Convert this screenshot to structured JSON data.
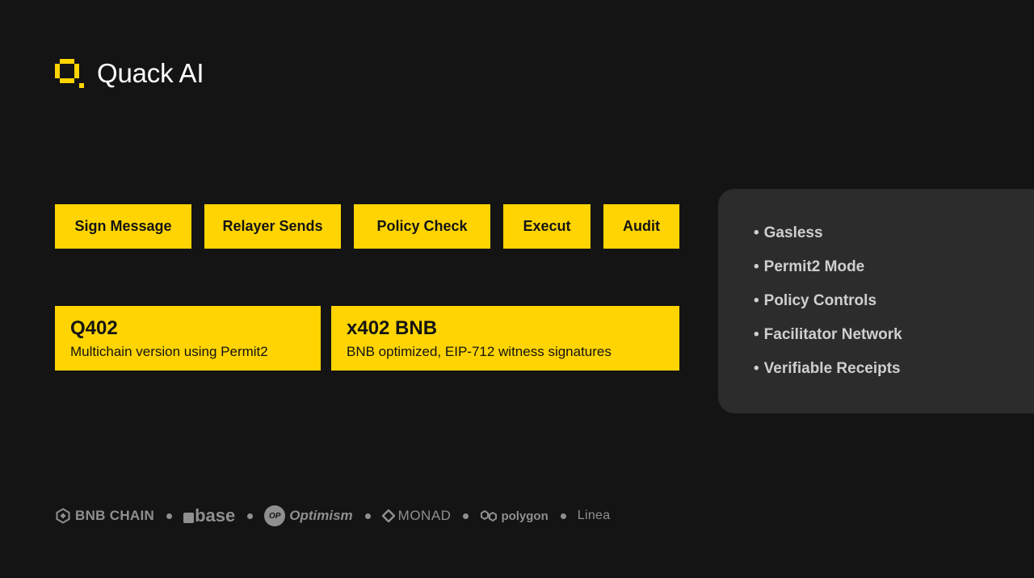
{
  "brand": {
    "name": "Quack AI",
    "logo_icon": "quack-logo-icon",
    "accent_color": "#ffd400"
  },
  "flow": {
    "steps": [
      "Sign Message",
      "Relayer Sends",
      "Policy Check",
      "Execut",
      "Audit"
    ]
  },
  "versions": [
    {
      "title": "Q402",
      "description": "Multichain version using Permit2"
    },
    {
      "title": "x402 BNB",
      "description": "BNB optimized, EIP-712 witness signatures"
    }
  ],
  "features": {
    "bullet": "•",
    "items": [
      "Gasless",
      "Permit2 Mode",
      "Policy Controls",
      "Facilitator Network",
      "Verifiable Receipts"
    ]
  },
  "chains": {
    "bnb": {
      "label": "BNB CHAIN",
      "icon": "bnb-chain-icon"
    },
    "base": {
      "label": "base",
      "icon": "base-square-icon"
    },
    "optimism": {
      "label": "Optimism",
      "badge": "OP",
      "icon": "optimism-badge-icon"
    },
    "monad": {
      "label": "MONAD",
      "icon": "monad-diamond-icon"
    },
    "polygon": {
      "label": "polygon",
      "icon": "polygon-link-icon"
    },
    "linea": {
      "label": "Linea",
      "icon": "linea-wordmark"
    }
  }
}
